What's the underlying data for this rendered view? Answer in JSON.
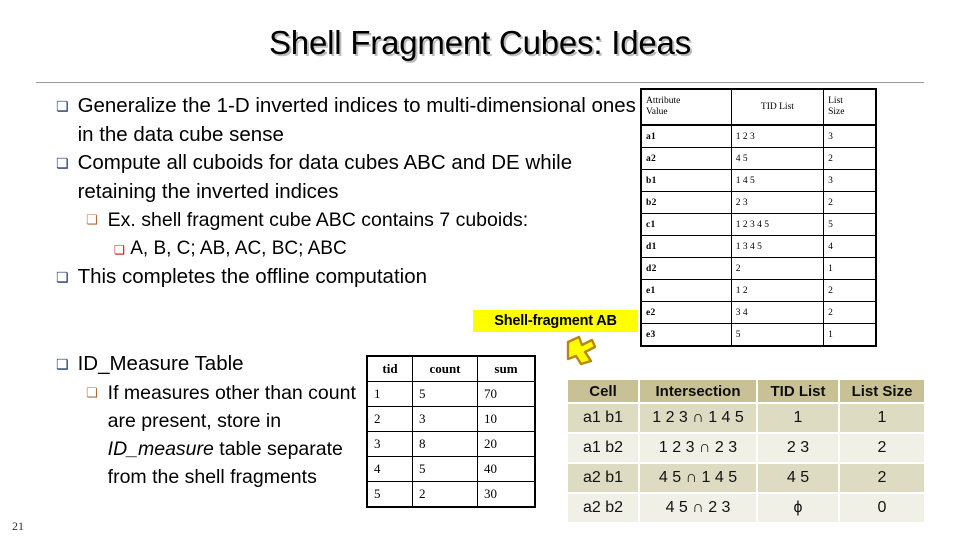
{
  "slide": {
    "title": "Shell Fragment Cubes: Ideas",
    "page_number": "21"
  },
  "bullets_upper": [
    {
      "level": 1,
      "marker": "❏",
      "text": "Generalize the 1-D inverted indices to multi-dimensional ones in the data cube sense"
    },
    {
      "level": 1,
      "marker": "❏",
      "text": "Compute all cuboids for data cubes ABC and DE while retaining the inverted indices"
    },
    {
      "level": 2,
      "marker": "❏",
      "text": "Ex. shell fragment cube ABC contains 7 cuboids:"
    },
    {
      "level": 3,
      "marker": "❏",
      "text": "A, B, C; AB, AC, BC; ABC"
    },
    {
      "level": 1,
      "marker": "❏",
      "text": "This completes the offline computation"
    }
  ],
  "bullets_lower": [
    {
      "level": 1,
      "marker": "❏",
      "text": "ID_Measure Table"
    },
    {
      "level": 2,
      "marker": "❏",
      "text_before": "If measures other than count are present, store in ",
      "text_italic": "ID_measure",
      "text_after": " table separate from the shell fragments"
    }
  ],
  "attribute_table": {
    "headers": [
      "Attribute Value",
      "TID List",
      "List Size"
    ],
    "header_lines": [
      [
        "Attribute",
        "Value"
      ],
      [
        "TID List"
      ],
      [
        "List",
        "Size"
      ]
    ],
    "rows": [
      {
        "attribute_value": "a1",
        "tid_list": "1  2  3",
        "list_size": "3"
      },
      {
        "attribute_value": "a2",
        "tid_list": "4  5",
        "list_size": "2"
      },
      {
        "attribute_value": "b1",
        "tid_list": "1  4  5",
        "list_size": "3"
      },
      {
        "attribute_value": "b2",
        "tid_list": "2  3",
        "list_size": "2"
      },
      {
        "attribute_value": "c1",
        "tid_list": "1  2  3  4  5",
        "list_size": "5"
      },
      {
        "attribute_value": "d1",
        "tid_list": "1  3  4  5",
        "list_size": "4"
      },
      {
        "attribute_value": "d2",
        "tid_list": "2",
        "list_size": "1"
      },
      {
        "attribute_value": "e1",
        "tid_list": "1  2",
        "list_size": "2"
      },
      {
        "attribute_value": "e2",
        "tid_list": "3  4",
        "list_size": "2"
      },
      {
        "attribute_value": "e3",
        "tid_list": "5",
        "list_size": "1"
      }
    ]
  },
  "id_measure_table": {
    "headers": [
      "tid",
      "count",
      "sum"
    ],
    "rows": [
      {
        "tid": "1",
        "count": "5",
        "sum": "70"
      },
      {
        "tid": "2",
        "count": "3",
        "sum": "10"
      },
      {
        "tid": "3",
        "count": "8",
        "sum": "20"
      },
      {
        "tid": "4",
        "count": "5",
        "sum": "40"
      },
      {
        "tid": "5",
        "count": "2",
        "sum": "30"
      }
    ]
  },
  "callout": {
    "label": "Shell-fragment AB",
    "highlight_color": "#ffff00",
    "arrow_fill": "#ffff00",
    "arrow_stroke": "#b8860b"
  },
  "cell_table": {
    "headers": [
      "Cell",
      "Intersection",
      "TID List",
      "List Size"
    ],
    "header_bg": "#c8c195",
    "row_bg_odd": "#dedbc3",
    "row_bg_even": "#f1f0e7",
    "rows": [
      {
        "cell": "a1 b1",
        "intersection": "1 2 3 ∩ 1 4 5",
        "tid_list": "1",
        "list_size": "1"
      },
      {
        "cell": "a1 b2",
        "intersection": "1 2 3 ∩ 2 3",
        "tid_list": "2 3",
        "list_size": "2"
      },
      {
        "cell": "a2 b1",
        "intersection": "4 5 ∩ 1 4 5",
        "tid_list": "4 5",
        "list_size": "2"
      },
      {
        "cell": "a2 b2",
        "intersection": "4 5 ∩ 2 3",
        "tid_list": "ϕ",
        "list_size": "0"
      }
    ]
  }
}
